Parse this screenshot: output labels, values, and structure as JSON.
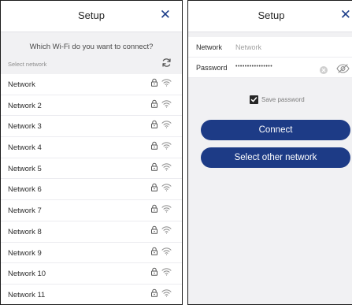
{
  "left": {
    "title": "Setup",
    "close": "✕",
    "question": "Which Wi-Fi do you want to connect?",
    "select_label": "Select network",
    "refresh_icon": "refresh-icon",
    "networks": [
      {
        "name": "Network"
      },
      {
        "name": "Network 2"
      },
      {
        "name": "Network 3"
      },
      {
        "name": "Network 4"
      },
      {
        "name": "Network 5"
      },
      {
        "name": "Network 6"
      },
      {
        "name": "Network 7"
      },
      {
        "name": "Network 8"
      },
      {
        "name": "Network 9"
      },
      {
        "name": "Network 10"
      },
      {
        "name": "Network 11"
      }
    ]
  },
  "right": {
    "title": "Setup",
    "close": "✕",
    "network_label": "Network",
    "network_placeholder": "Network",
    "password_label": "Password",
    "password_dots": "••••••••••••••••",
    "save_password_label": "Save password",
    "save_password_checked": true,
    "connect_label": "Connect",
    "other_network_label": "Select other network"
  },
  "colors": {
    "accent": "#1d3b86",
    "background": "#f1f1f3"
  }
}
